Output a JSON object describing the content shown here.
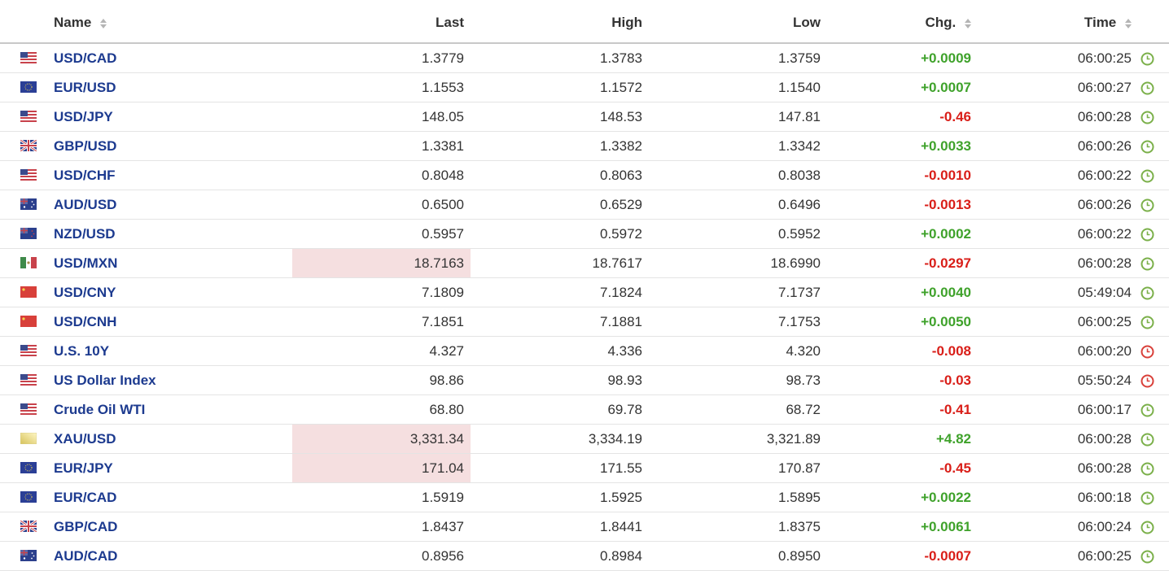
{
  "columns": {
    "name": "Name",
    "last": "Last",
    "high": "High",
    "low": "Low",
    "chg": "Chg.",
    "time": "Time"
  },
  "colors": {
    "up": "#3fa22b",
    "down": "#d91e18",
    "link": "#1c3a8f",
    "highlight": "#f5dfe0"
  },
  "rows": [
    {
      "flag": "us-flag-icon",
      "name": "USD/CAD",
      "last": "1.3779",
      "high": "1.3783",
      "low": "1.3759",
      "chg": "+0.0009",
      "dir": "up",
      "time": "06:00:25",
      "clock": "green",
      "hl": false
    },
    {
      "flag": "eu-flag-icon",
      "name": "EUR/USD",
      "last": "1.1553",
      "high": "1.1572",
      "low": "1.1540",
      "chg": "+0.0007",
      "dir": "up",
      "time": "06:00:27",
      "clock": "green",
      "hl": false
    },
    {
      "flag": "us-flag-icon",
      "name": "USD/JPY",
      "last": "148.05",
      "high": "148.53",
      "low": "147.81",
      "chg": "-0.46",
      "dir": "down",
      "time": "06:00:28",
      "clock": "green",
      "hl": false
    },
    {
      "flag": "uk-flag-icon",
      "name": "GBP/USD",
      "last": "1.3381",
      "high": "1.3382",
      "low": "1.3342",
      "chg": "+0.0033",
      "dir": "up",
      "time": "06:00:26",
      "clock": "green",
      "hl": false
    },
    {
      "flag": "us-flag-icon",
      "name": "USD/CHF",
      "last": "0.8048",
      "high": "0.8063",
      "low": "0.8038",
      "chg": "-0.0010",
      "dir": "down",
      "time": "06:00:22",
      "clock": "green",
      "hl": false
    },
    {
      "flag": "au-flag-icon",
      "name": "AUD/USD",
      "last": "0.6500",
      "high": "0.6529",
      "low": "0.6496",
      "chg": "-0.0013",
      "dir": "down",
      "time": "06:00:26",
      "clock": "green",
      "hl": false
    },
    {
      "flag": "nz-flag-icon",
      "name": "NZD/USD",
      "last": "0.5957",
      "high": "0.5972",
      "low": "0.5952",
      "chg": "+0.0002",
      "dir": "up",
      "time": "06:00:22",
      "clock": "green",
      "hl": false
    },
    {
      "flag": "us-flag-icon",
      "name": "USD/MXN",
      "last": "18.7163",
      "high": "18.7617",
      "low": "18.6990",
      "chg": "-0.0297",
      "dir": "down",
      "time": "06:00:28",
      "clock": "green",
      "hl": true
    },
    {
      "flag": "us-flag-icon",
      "name": "USD/CNY",
      "last": "7.1809",
      "high": "7.1824",
      "low": "7.1737",
      "chg": "+0.0040",
      "dir": "up",
      "time": "05:49:04",
      "clock": "green",
      "hl": false
    },
    {
      "flag": "us-flag-icon",
      "name": "USD/CNH",
      "last": "7.1851",
      "high": "7.1881",
      "low": "7.1753",
      "chg": "+0.0050",
      "dir": "up",
      "time": "06:00:25",
      "clock": "green",
      "hl": false
    },
    {
      "flag": "us-flag-icon",
      "name": "U.S. 10Y",
      "last": "4.327",
      "high": "4.336",
      "low": "4.320",
      "chg": "-0.008",
      "dir": "down",
      "time": "06:00:20",
      "clock": "red",
      "hl": false
    },
    {
      "flag": "us-flag-icon",
      "name": "US Dollar Index",
      "last": "98.86",
      "high": "98.93",
      "low": "98.73",
      "chg": "-0.03",
      "dir": "down",
      "time": "05:50:24",
      "clock": "red",
      "hl": false
    },
    {
      "flag": "us-flag-icon",
      "name": "Crude Oil WTI",
      "last": "68.80",
      "high": "69.78",
      "low": "68.72",
      "chg": "-0.41",
      "dir": "down",
      "time": "06:00:17",
      "clock": "green",
      "hl": false
    },
    {
      "flag": "gold-icon",
      "name": "XAU/USD",
      "last": "3,331.34",
      "high": "3,334.19",
      "low": "3,321.89",
      "chg": "+4.82",
      "dir": "up",
      "time": "06:00:28",
      "clock": "green",
      "hl": true
    },
    {
      "flag": "eu-flag-icon",
      "name": "EUR/JPY",
      "last": "171.04",
      "high": "171.55",
      "low": "170.87",
      "chg": "-0.45",
      "dir": "down",
      "time": "06:00:28",
      "clock": "green",
      "hl": true
    },
    {
      "flag": "eu-flag-icon",
      "name": "EUR/CAD",
      "last": "1.5919",
      "high": "1.5925",
      "low": "1.5895",
      "chg": "+0.0022",
      "dir": "up",
      "time": "06:00:18",
      "clock": "green",
      "hl": false
    },
    {
      "flag": "uk-flag-icon",
      "name": "GBP/CAD",
      "last": "1.8437",
      "high": "1.8441",
      "low": "1.8375",
      "chg": "+0.0061",
      "dir": "up",
      "time": "06:00:24",
      "clock": "green",
      "hl": false
    },
    {
      "flag": "au-flag-icon",
      "name": "AUD/CAD",
      "last": "0.8956",
      "high": "0.8984",
      "low": "0.8950",
      "chg": "-0.0007",
      "dir": "down",
      "time": "06:00:25",
      "clock": "green",
      "hl": false
    }
  ]
}
